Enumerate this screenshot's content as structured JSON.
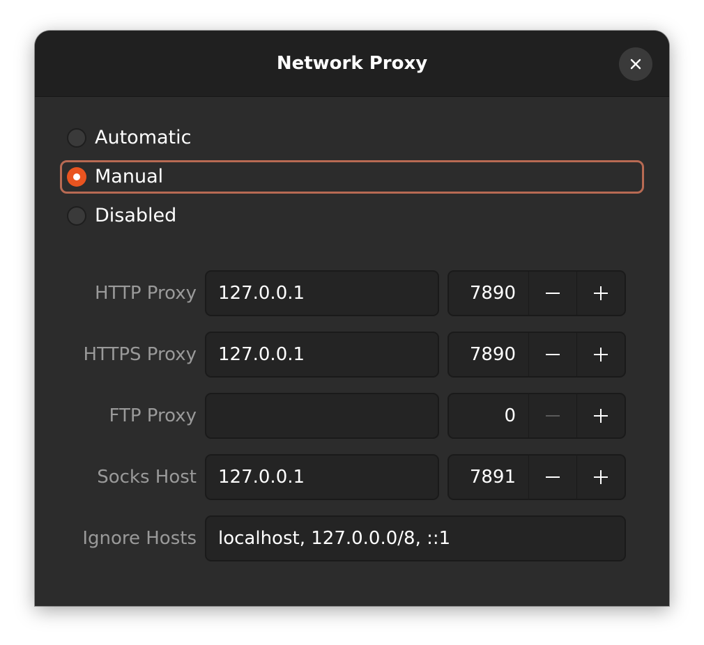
{
  "dialog": {
    "title": "Network Proxy",
    "close_icon": "close-icon"
  },
  "method": {
    "options": [
      {
        "label": "Automatic",
        "checked": false
      },
      {
        "label": "Manual",
        "checked": true
      },
      {
        "label": "Disabled",
        "checked": false
      }
    ]
  },
  "proxies": [
    {
      "label": "HTTP Proxy",
      "host": "127.0.0.1",
      "port": "7890",
      "minus_enabled": true
    },
    {
      "label": "HTTPS Proxy",
      "host": "127.0.0.1",
      "port": "7890",
      "minus_enabled": true
    },
    {
      "label": "FTP Proxy",
      "host": "",
      "port": "0",
      "minus_enabled": false
    },
    {
      "label": "Socks Host",
      "host": "127.0.0.1",
      "port": "7891",
      "minus_enabled": true
    }
  ],
  "ignore_hosts": {
    "label": "Ignore Hosts",
    "value": "localhost, 127.0.0.0/8, ::1"
  },
  "colors": {
    "accent": "#e95420",
    "focus_ring": "#b86a53",
    "window_bg": "#2c2c2c",
    "header_bg": "#202020"
  }
}
